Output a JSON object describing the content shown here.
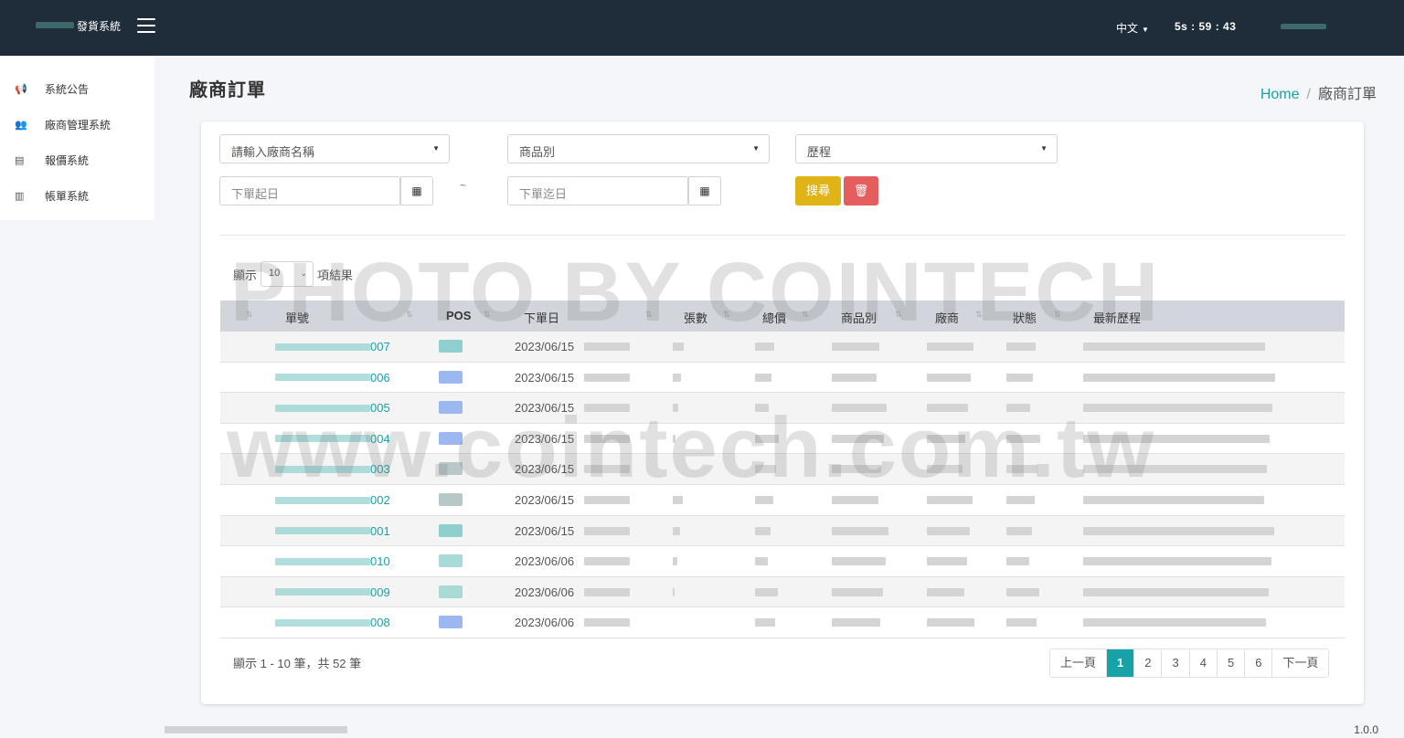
{
  "header": {
    "brand": "發貨系統",
    "language": "中文",
    "timer": "5s : 59 : 43"
  },
  "sidebar": {
    "items": [
      {
        "label": "系統公告",
        "icon": "megaphone-icon"
      },
      {
        "label": "廠商管理系統",
        "icon": "users-icon"
      },
      {
        "label": "報價系統",
        "icon": "quote-doc-icon"
      },
      {
        "label": "帳單系統",
        "icon": "bill-doc-icon"
      }
    ]
  },
  "page": {
    "title": "廠商訂單",
    "breadcrumb": {
      "home": "Home",
      "sep": "/",
      "current": "廠商訂單"
    }
  },
  "filters": {
    "vendor_placeholder": "請輸入廠商名稱",
    "category_placeholder": "商品別",
    "history_placeholder": "歷程",
    "start_placeholder": "下單起日",
    "end_placeholder": "下單迄日",
    "tilde": "~",
    "search_label": "搜尋"
  },
  "table": {
    "length_prefix": "顯示",
    "length_value": "10",
    "length_suffix": "項結果",
    "columns": [
      "單號",
      "POS",
      "下單日",
      "張數",
      "總價",
      "商品別",
      "廠商",
      "狀態",
      "最新歷程"
    ],
    "rows": [
      {
        "id_suffix": "007",
        "date": "2023/06/15"
      },
      {
        "id_suffix": "006",
        "date": "2023/06/15"
      },
      {
        "id_suffix": "005",
        "date": "2023/06/15"
      },
      {
        "id_suffix": "004",
        "date": "2023/06/15"
      },
      {
        "id_suffix": "003",
        "date": "2023/06/15"
      },
      {
        "id_suffix": "002",
        "date": "2023/06/15"
      },
      {
        "id_suffix": "001",
        "date": "2023/06/15"
      },
      {
        "id_suffix": "010",
        "date": "2023/06/06"
      },
      {
        "id_suffix": "009",
        "date": "2023/06/06"
      },
      {
        "id_suffix": "008",
        "date": "2023/06/06"
      }
    ],
    "info": "顯示 1 - 10 筆，共 52 筆"
  },
  "pagination": {
    "prev": "上一頁",
    "pages": [
      "1",
      "2",
      "3",
      "4",
      "5",
      "6"
    ],
    "active": "1",
    "next": "下一頁"
  },
  "footer": {
    "version": "1.0.0"
  },
  "watermark": {
    "line1": "PHOTO BY COINTECH",
    "line2": "www.cointech.com.tw"
  },
  "colors": {
    "navbar": "#1f2d3a",
    "accent": "#17a2a8",
    "search": "#e0b416",
    "danger": "#e65d5d"
  }
}
